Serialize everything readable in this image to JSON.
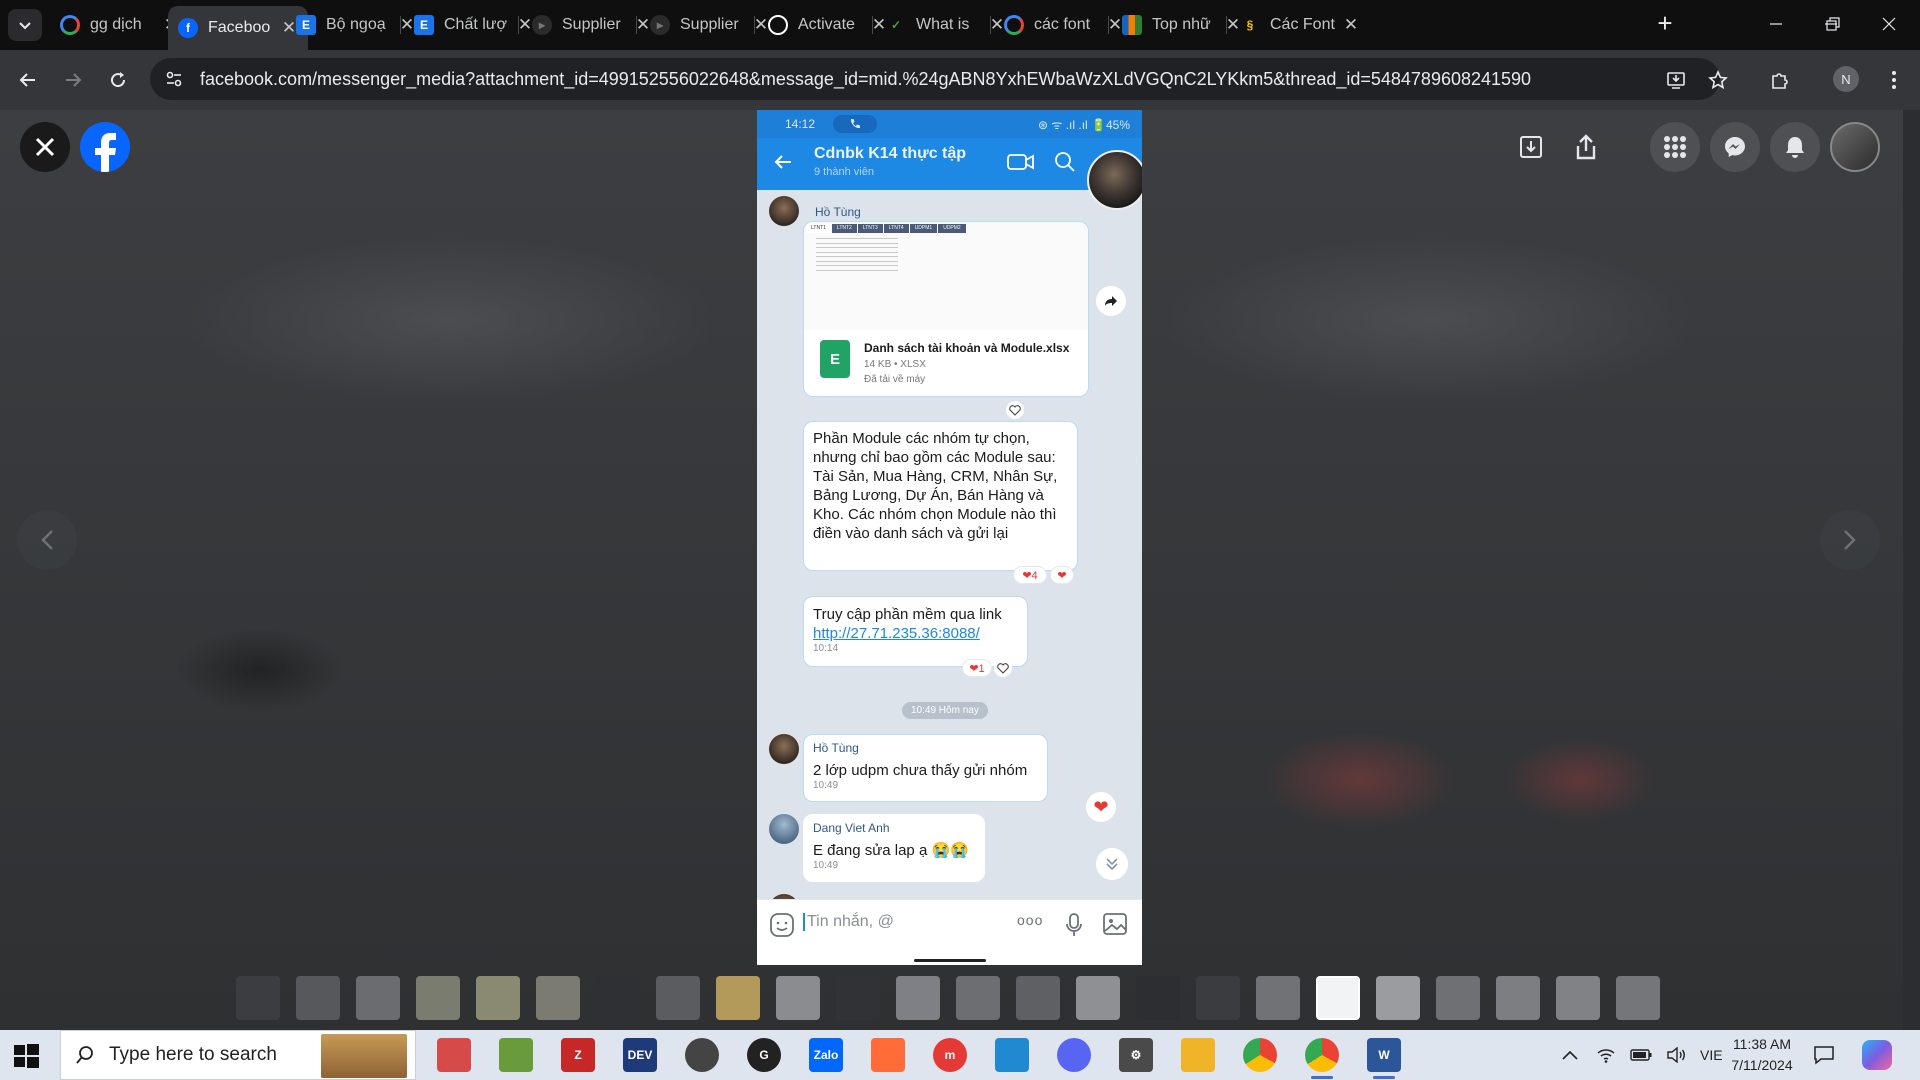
{
  "browser": {
    "tabs": [
      {
        "title": "gg dịch",
        "favicon": "google-icon",
        "color": "#ffffff"
      },
      {
        "title": "Faceboo",
        "favicon": "facebook-icon",
        "color": "#0866ff",
        "active": true
      },
      {
        "title": "Bộ ngoạ",
        "favicon": "e-icon",
        "color": "#1a73e8"
      },
      {
        "title": "Chất lượ",
        "favicon": "e-icon",
        "color": "#1a73e8"
      },
      {
        "title": "Supplier",
        "favicon": "f-icon",
        "color": "#2b2b2b"
      },
      {
        "title": "Supplier",
        "favicon": "f-icon",
        "color": "#2b2b2b"
      },
      {
        "title": "Activate",
        "favicon": "chatgpt-icon",
        "color": "#ffffff"
      },
      {
        "title": "What is",
        "favicon": "leaf-icon",
        "color": "#2e7d32"
      },
      {
        "title": "các font",
        "favicon": "google-icon",
        "color": "#ffffff"
      },
      {
        "title": "Top nhữ",
        "favicon": "fpt-icon",
        "color": "#f57c00"
      },
      {
        "title": "Các Font",
        "favicon": "bookmark-icon",
        "color": "#f9c400"
      }
    ],
    "tab_close_glyph": "✕",
    "new_tab_glyph": "+",
    "url": "facebook.com/messenger_media?attachment_id=499152556022648&message_id=mid.%24gABN8YxhEWbaWzXLdVGQnC2LYKkm5&thread_id=5484789608241590",
    "profile_initial": "N"
  },
  "phone": {
    "status_time": "14:12",
    "status_right": "⊛ ᯤ .ıl .ıl 🔋45%",
    "chat_title": "Cdnbk K14 thực tập",
    "chat_subtitle": "9 thành viên",
    "messages": {
      "sender1": "Hồ Tùng",
      "sheet_tabs": [
        "LTNT1",
        "LTNT2",
        "LTNT3",
        "LTNT4",
        "UDPM1",
        "UDPM2"
      ],
      "file_name": "Danh sách tài khoản và Module.xlsx",
      "file_meta": "14 KB • XLSX",
      "file_saved": "Đã tải về máy",
      "file_icon_letter": "E",
      "msg_module": "Phần Module các nhóm tự chọn, nhưng chỉ bao gồm các Module sau: Tài Sản, Mua Hàng, CRM, Nhân Sự, Bảng Lương, Dự Án, Bán Hàng và Kho. Các nhóm chọn Module nào thì điền vào danh sách và gửi lại",
      "react_module": "❤4",
      "msg_link_text": "Truy cập phần mềm qua link",
      "msg_link_url": "http://27.71.235.36:8088/",
      "msg_link_time": "10:14",
      "react_link": "❤1",
      "date_divider": "10:49 Hôm nay",
      "sender2": "Hồ Tùng",
      "msg_udpm": "2 lớp udpm chưa thấy gửi nhóm",
      "msg_udpm_time": "10:49",
      "sender3": "Dang Viet Anh",
      "msg_lap": "E đang sửa lap ạ 😭😭",
      "msg_lap_time": "10:49"
    },
    "input_placeholder": "Tin nhắn, @",
    "input_more": "ooo"
  },
  "taskbar": {
    "search_placeholder": "Type here to search",
    "language": "VIE",
    "time": "11:38 AM",
    "date": "7/11/2024",
    "apps": [
      {
        "name": "snipping-tool-icon",
        "color": "#d64a4a",
        "label": ""
      },
      {
        "name": "color-picker-icon",
        "color": "#6a9b3a",
        "label": ""
      },
      {
        "name": "filezilla-icon",
        "color": "#c62828",
        "label": "Z"
      },
      {
        "name": "devc-icon",
        "color": "#1f3a7a",
        "label": "DEV"
      },
      {
        "name": "clock-app-icon",
        "color": "#444444",
        "label": ""
      },
      {
        "name": "github-desktop-icon",
        "color": "#222222",
        "label": "G"
      },
      {
        "name": "zalo-icon",
        "color": "#0068ff",
        "label": "Zalo"
      },
      {
        "name": "postman-icon",
        "color": "#ff6c37",
        "label": ""
      },
      {
        "name": "meet-app-icon",
        "color": "#e53935",
        "label": "m"
      },
      {
        "name": "vscode-icon",
        "color": "#1f8ad2",
        "label": ""
      },
      {
        "name": "discord-icon",
        "color": "#5865f2",
        "label": ""
      },
      {
        "name": "settings-icon",
        "color": "#4a4a4a",
        "label": "⚙"
      },
      {
        "name": "file-explorer-icon",
        "color": "#f0b429",
        "label": ""
      },
      {
        "name": "chrome-icon",
        "color": "#34a853",
        "label": ""
      },
      {
        "name": "chrome-profile-icon",
        "color": "#34a853",
        "label": "",
        "active": true
      },
      {
        "name": "word-icon",
        "color": "#2b579a",
        "label": "W",
        "active": true
      }
    ]
  },
  "colors": {
    "facebook_blue": "#0866ff",
    "zalo_blue": "#1e88e5",
    "heart_red": "#e53935",
    "bubble_border": "#b9dcf6"
  }
}
